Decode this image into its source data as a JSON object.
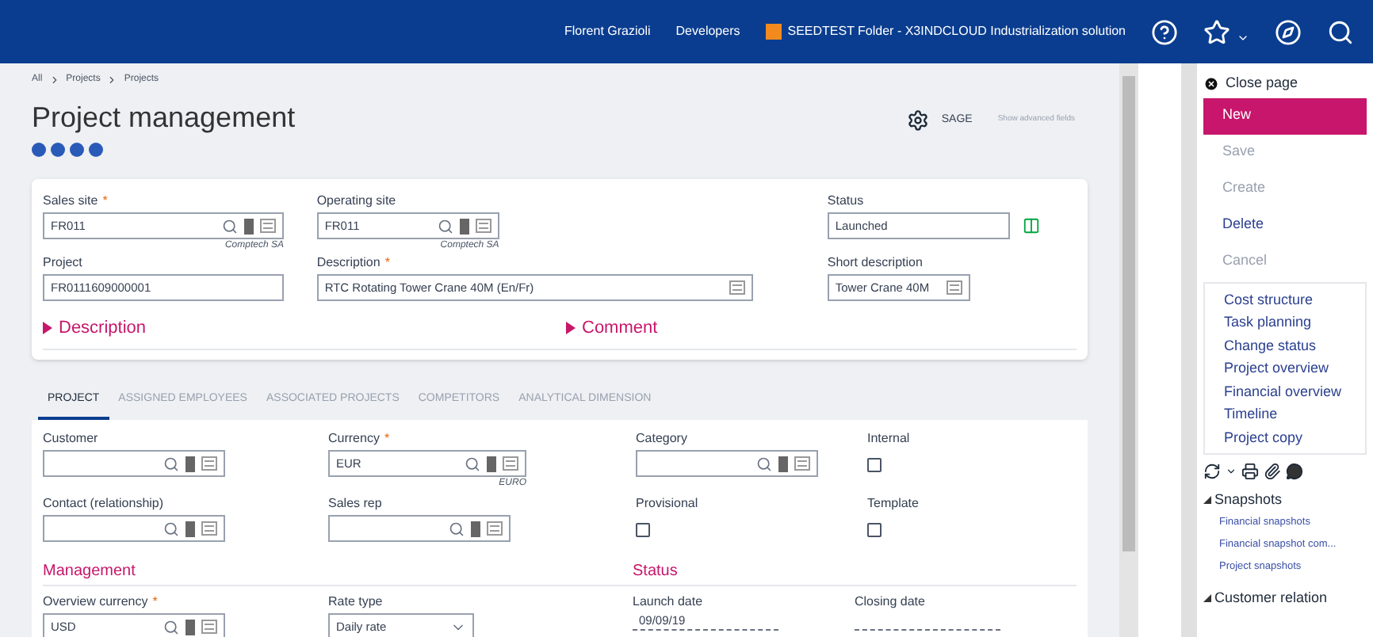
{
  "topbar": {
    "user": "Florent Grazioli",
    "role": "Developers",
    "folder": "SEEDTEST Folder - X3INDCLOUD Industrialization solution"
  },
  "breadcrumb": [
    "All",
    "Projects",
    "Projects"
  ],
  "title": "Project management",
  "header_actions": {
    "sage": "SAGE",
    "advanced": "Show advanced fields"
  },
  "header_card": {
    "rows": [
      [
        {
          "label": "Sales site",
          "required_mark": "*",
          "value": "FR011",
          "kind": "lookup",
          "caption": "Comptech SA"
        },
        {
          "label": "Operating site",
          "value": "FR011",
          "kind": "lookup",
          "caption": "Comptech SA"
        },
        {
          "label": "Status",
          "value": "Launched",
          "kind": "status"
        }
      ],
      [
        {
          "label": "Project",
          "value": "FR0111609000001",
          "kind": "plain"
        },
        {
          "label": "Description",
          "required_mark": "*",
          "value": "RTC Rotating Tower Crane 40M (En/Fr)",
          "kind": "text"
        },
        {
          "label": "Short description",
          "value": "Tower Crane 40M",
          "kind": "text"
        }
      ]
    ],
    "sections": [
      {
        "label": "Description",
        "expanded": false
      },
      {
        "label": "Comment",
        "expanded": false
      }
    ]
  },
  "tabs": [
    {
      "label": "PROJECT",
      "selected": true
    },
    {
      "label": "ASSIGNED EMPLOYEES",
      "selected": false
    },
    {
      "label": "ASSOCIATED PROJECTS",
      "selected": false
    },
    {
      "label": "COMPETITORS",
      "selected": false
    },
    {
      "label": "ANALYTICAL DIMENSION",
      "selected": false
    }
  ],
  "project_tab": {
    "rows": [
      [
        {
          "label": "Customer",
          "kind": "lookup"
        },
        {
          "label": "Currency",
          "required_mark": "*",
          "value": "EUR",
          "kind": "lookup",
          "caption": "EURO"
        },
        {
          "label": "Category",
          "kind": "lookup"
        },
        {
          "label": "Internal",
          "kind": "checkbox",
          "checked": false
        }
      ],
      [
        {
          "label": "Contact (relationship)",
          "kind": "lookup"
        },
        {
          "label": "Sales rep",
          "kind": "lookup"
        },
        {
          "label": "Provisional",
          "kind": "checkbox",
          "checked": false
        },
        {
          "label": "Template",
          "kind": "checkbox",
          "checked": false
        }
      ]
    ],
    "sections": [
      {
        "title": "Management",
        "fields": [
          {
            "label": "Overview currency",
            "required_mark": "*",
            "value": "USD",
            "kind": "lookup"
          },
          {
            "label": "Rate type",
            "value": "Daily rate",
            "kind": "select"
          }
        ]
      },
      {
        "title": "Status",
        "fields": [
          {
            "label": "Launch date",
            "value": "09/09/19",
            "kind": "date"
          },
          {
            "label": "Closing date",
            "kind": "date"
          }
        ]
      }
    ]
  },
  "side_panel": {
    "close": "Close page",
    "actions": [
      {
        "label": "New",
        "kind": "primary"
      },
      {
        "label": "Save",
        "kind": "disabled"
      },
      {
        "label": "Create",
        "kind": "disabled"
      },
      {
        "label": "Delete",
        "kind": "normal"
      },
      {
        "label": "Cancel",
        "kind": "disabled"
      }
    ],
    "links": [
      "Cost structure",
      "Task planning",
      "Change status",
      "Project overview",
      "Financial overview",
      "Timeline",
      "Project copy"
    ],
    "groups": [
      {
        "title": "Snapshots",
        "expanded": true,
        "items": [
          "Financial snapshots",
          "Financial snapshot com...",
          "Project snapshots"
        ]
      },
      {
        "title": "Customer relation",
        "expanded": true
      }
    ]
  }
}
